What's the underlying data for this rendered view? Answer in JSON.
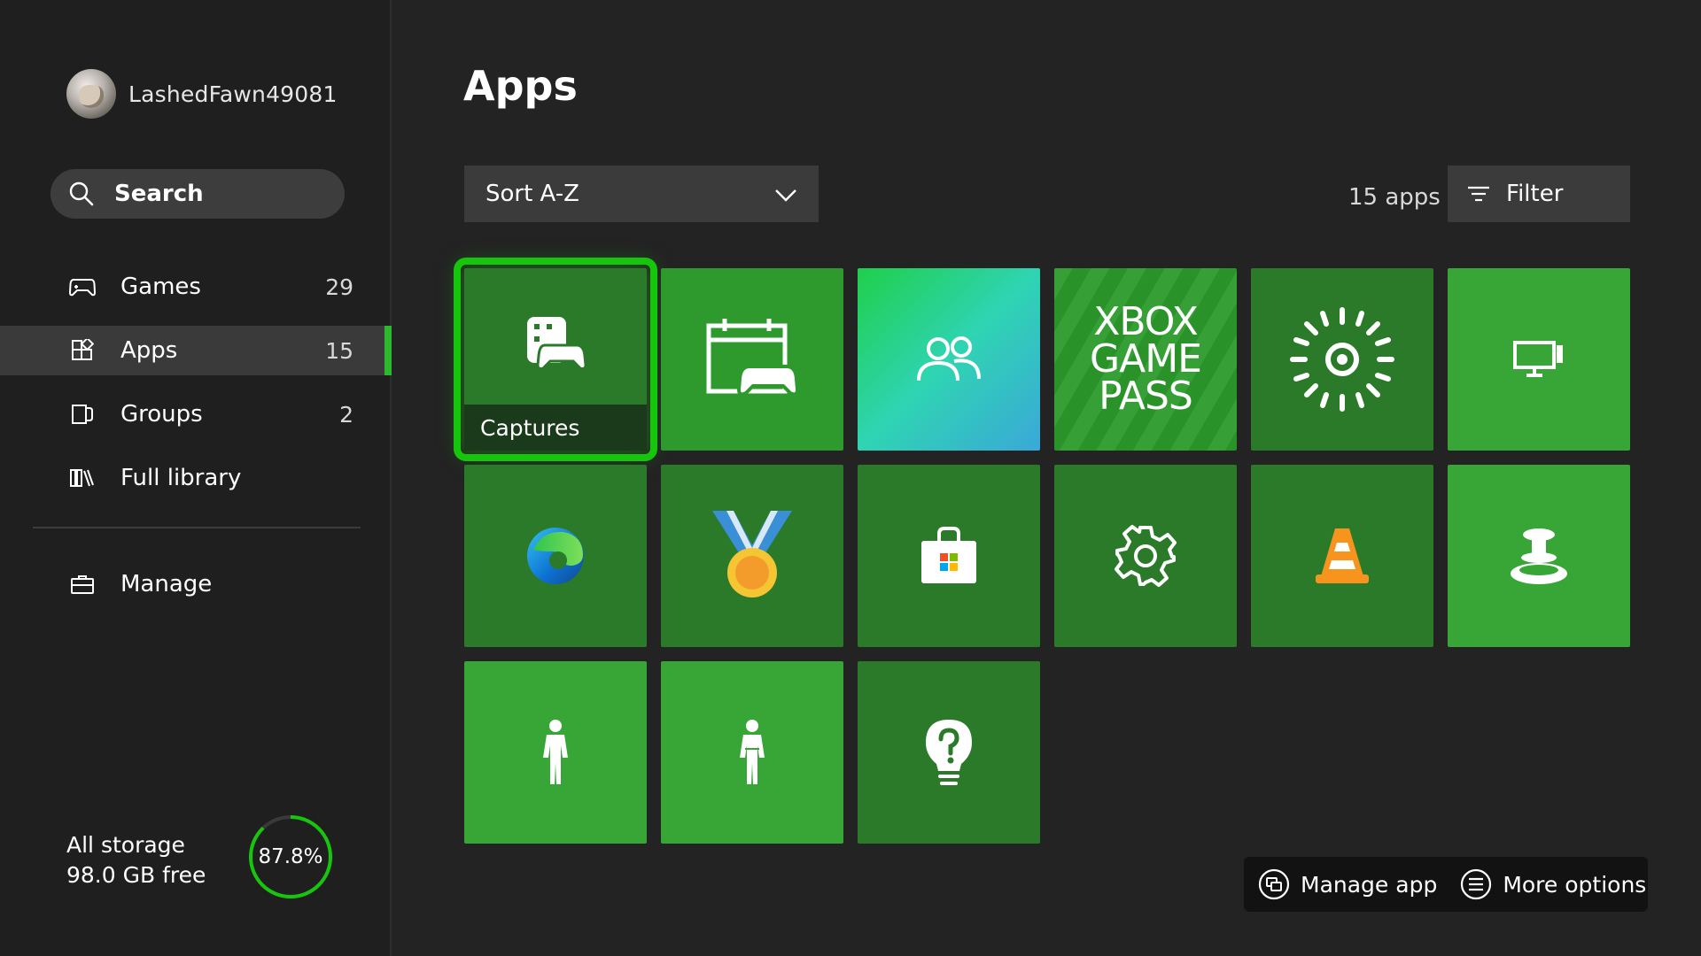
{
  "profile": {
    "username": "LashedFawn49081"
  },
  "search": {
    "label": "Search"
  },
  "nav": {
    "items": [
      {
        "label": "Games",
        "count": "29",
        "icon": "gamepad-icon"
      },
      {
        "label": "Apps",
        "count": "15",
        "icon": "apps-icon",
        "active": true
      },
      {
        "label": "Groups",
        "count": "2",
        "icon": "groups-icon"
      },
      {
        "label": "Full library",
        "count": "",
        "icon": "library-icon"
      }
    ],
    "manage": {
      "label": "Manage",
      "icon": "briefcase-icon"
    }
  },
  "storage": {
    "title": "All storage",
    "free": "98.0 GB free",
    "used_percent_label": "87.8%",
    "used_fraction": 0.878
  },
  "main": {
    "title": "Apps",
    "sort": {
      "label": "Sort A-Z"
    },
    "app_count": "15 apps",
    "filter": {
      "label": "Filter"
    }
  },
  "tiles": [
    {
      "icon": "captures-icon",
      "caption": "Captures",
      "selected": true
    },
    {
      "icon": "calendar-controller-icon"
    },
    {
      "icon": "people-icon"
    },
    {
      "icon": "xbox-game-pass-logo",
      "logo_lines": [
        "XBOX",
        "GAME",
        "PASS"
      ]
    },
    {
      "icon": "sun-burst-icon"
    },
    {
      "icon": "display-icon"
    },
    {
      "icon": "edge-browser-icon"
    },
    {
      "icon": "medal-icon"
    },
    {
      "icon": "microsoft-store-icon"
    },
    {
      "icon": "settings-gear-icon"
    },
    {
      "icon": "vlc-cone-icon"
    },
    {
      "icon": "joystick-icon"
    },
    {
      "icon": "avatar-figure-icon"
    },
    {
      "icon": "avatar-figure-icon"
    },
    {
      "icon": "tips-lightbulb-icon"
    }
  ],
  "hints": {
    "manage_app": "Manage app",
    "more_options": "More options"
  },
  "colors": {
    "accent": "#16c60c",
    "tile_dark": "#2a7a2a",
    "tile_bright": "#37a637",
    "background": "#232323"
  }
}
